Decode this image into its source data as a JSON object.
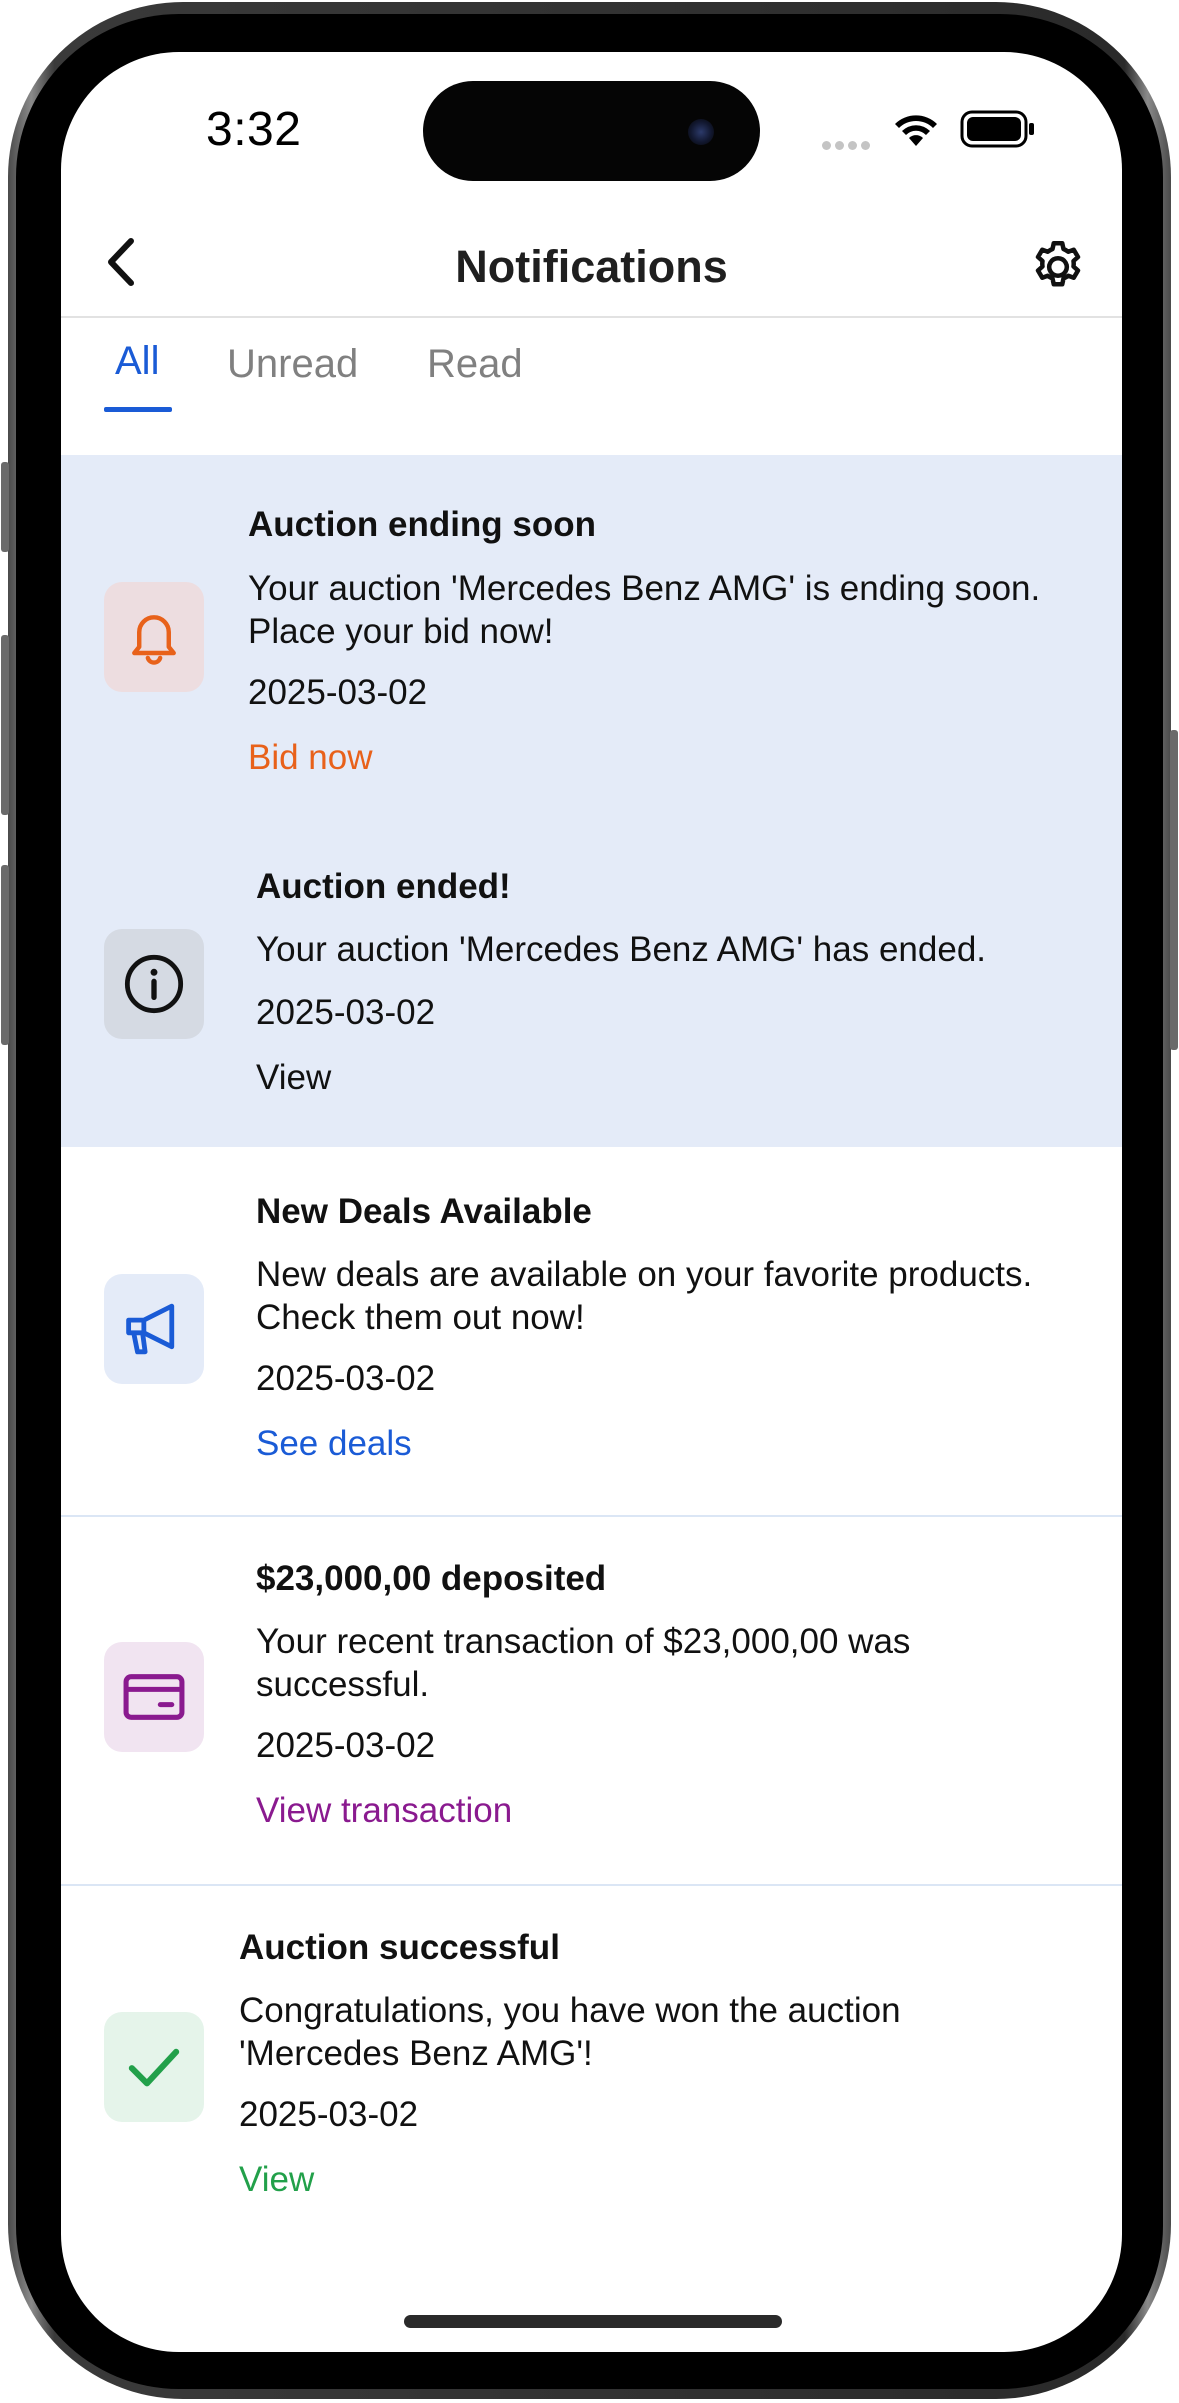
{
  "status_bar": {
    "time": "3:32"
  },
  "header": {
    "title": "Notifications"
  },
  "tabs": [
    {
      "label": "All",
      "active": true
    },
    {
      "label": "Unread",
      "active": false
    },
    {
      "label": "Read",
      "active": false
    }
  ],
  "notifications": [
    {
      "title": "Auction ending soon",
      "body": "Your auction 'Mercedes Benz AMG' is ending soon. Place your bid now!",
      "date": "2025-03-02",
      "action": "Bid now",
      "icon": "bell-icon",
      "unread": true,
      "accent": "#e8611a",
      "icon_bg": "#eddde0"
    },
    {
      "title": "Auction ended!",
      "body": "Your auction 'Mercedes Benz AMG' has ended.",
      "date": "2025-03-02",
      "action": "View",
      "icon": "info-icon",
      "unread": true,
      "accent": "#111111",
      "icon_bg": "#d5dae3"
    },
    {
      "title": "New Deals Available",
      "body": "New deals are available on your favorite products. Check them out now!",
      "date": "2025-03-02",
      "action": "See deals",
      "icon": "megaphone-icon",
      "unread": false,
      "accent": "#1a5bd6",
      "icon_bg": "#e4ebf8"
    },
    {
      "title": "$23,000,00 deposited",
      "body": "Your recent transaction of $23,000,00 was successful.",
      "date": "2025-03-02",
      "action": "View transaction",
      "icon": "credit-card-icon",
      "unread": false,
      "accent": "#8a1a8f",
      "icon_bg": "#f1e4f1"
    },
    {
      "title": "Auction successful",
      "body": "Congratulations, you have won the auction 'Mercedes Benz AMG'!",
      "date": "2025-03-02",
      "action": "View",
      "icon": "checkmark-icon",
      "unread": false,
      "accent": "#22a04a",
      "icon_bg": "#e5f4ea"
    }
  ]
}
